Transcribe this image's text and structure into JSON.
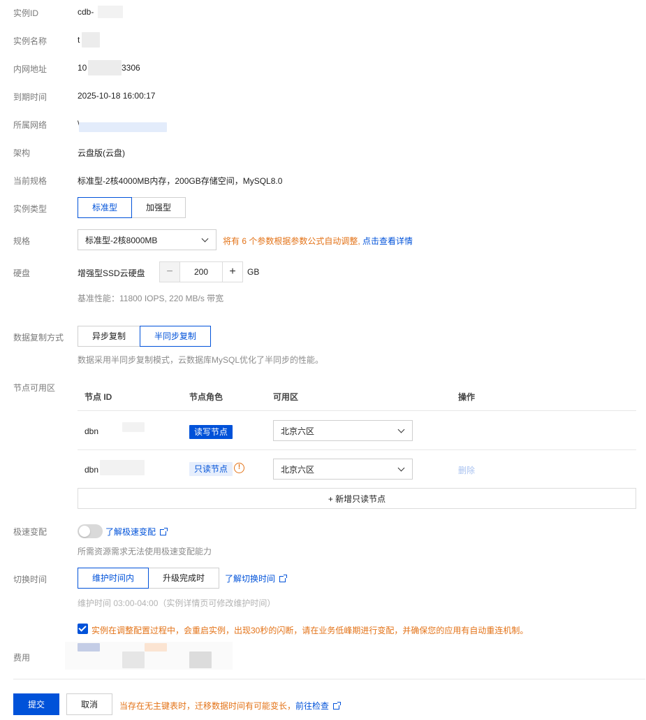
{
  "labels": {
    "instance_id": "实例ID",
    "instance_name": "实例名称",
    "private_address": "内网地址",
    "expire_time": "到期时间",
    "network": "所属网络",
    "architecture": "架构",
    "current_spec": "当前规格",
    "instance_type": "实例类型",
    "spec": "规格",
    "disk": "硬盘",
    "replication": "数据复制方式",
    "node_az": "节点可用区",
    "fast_change": "极速变配",
    "switch_time": "切换时间",
    "fee": "费用"
  },
  "values": {
    "instance_id": "cdb-",
    "instance_name": "t",
    "address_prefix": "10",
    "address_suffix": "3306",
    "expire_time": "2025-10-18 16:00:17",
    "network_prefix": "\\",
    "architecture": "云盘版(云盘)",
    "current_spec": "标准型-2核4000MB内存，200GB存储空间，MySQL8.0"
  },
  "instance_type": {
    "options": [
      "标准型",
      "加强型"
    ],
    "selected": "标准型"
  },
  "spec": {
    "selected": "标准型-2核8000MB",
    "notice": "将有 6 个参数根据参数公式自动调整,",
    "notice_link": "点击查看详情"
  },
  "disk": {
    "type": "增强型SSD云硬盘",
    "value": "200",
    "unit": "GB",
    "minus": "−",
    "plus": "+",
    "perf": "基准性能：11800 IOPS, 220 MB/s 带宽"
  },
  "replication": {
    "options": [
      "异步复制",
      "半同步复制"
    ],
    "selected": "半同步复制",
    "hint": "数据采用半同步复制模式，云数据库MySQL优化了半同步的性能。"
  },
  "nodes": {
    "headers": [
      "节点 ID",
      "节点角色",
      "可用区",
      "操作"
    ],
    "rows": [
      {
        "id": "dbn",
        "role": "读写节点",
        "az": "北京六区",
        "action": ""
      },
      {
        "id": "dbn",
        "role": "只读节点",
        "az": "北京六区",
        "action": "删除"
      }
    ],
    "add_label": "+ 新增只读节点",
    "warn_glyph": "!"
  },
  "fast_change": {
    "enabled": false,
    "link": "了解极速变配",
    "hint": "所需资源需求无法使用极速变配能力"
  },
  "switch_time": {
    "options": [
      "维护时间内",
      "升级完成时"
    ],
    "selected": "维护时间内",
    "link": "了解切换时间",
    "hint": "维护时间 03:00-04:00（实例详情页可修改维护时间）"
  },
  "confirm": {
    "checked": true,
    "text": "实例在调整配置过程中，会重启实例，出现30秒的闪断，请在业务低峰期进行变配，并确保您的应用有自动重连机制。"
  },
  "footer": {
    "submit": "提交",
    "cancel": "取消",
    "warning": "当存在无主键表时，迁移数据时间有可能变长，",
    "warning_link": "前往检查"
  },
  "colors": {
    "primary": "#0052d9",
    "warning": "#e37318",
    "label": "#7a7a7a"
  }
}
